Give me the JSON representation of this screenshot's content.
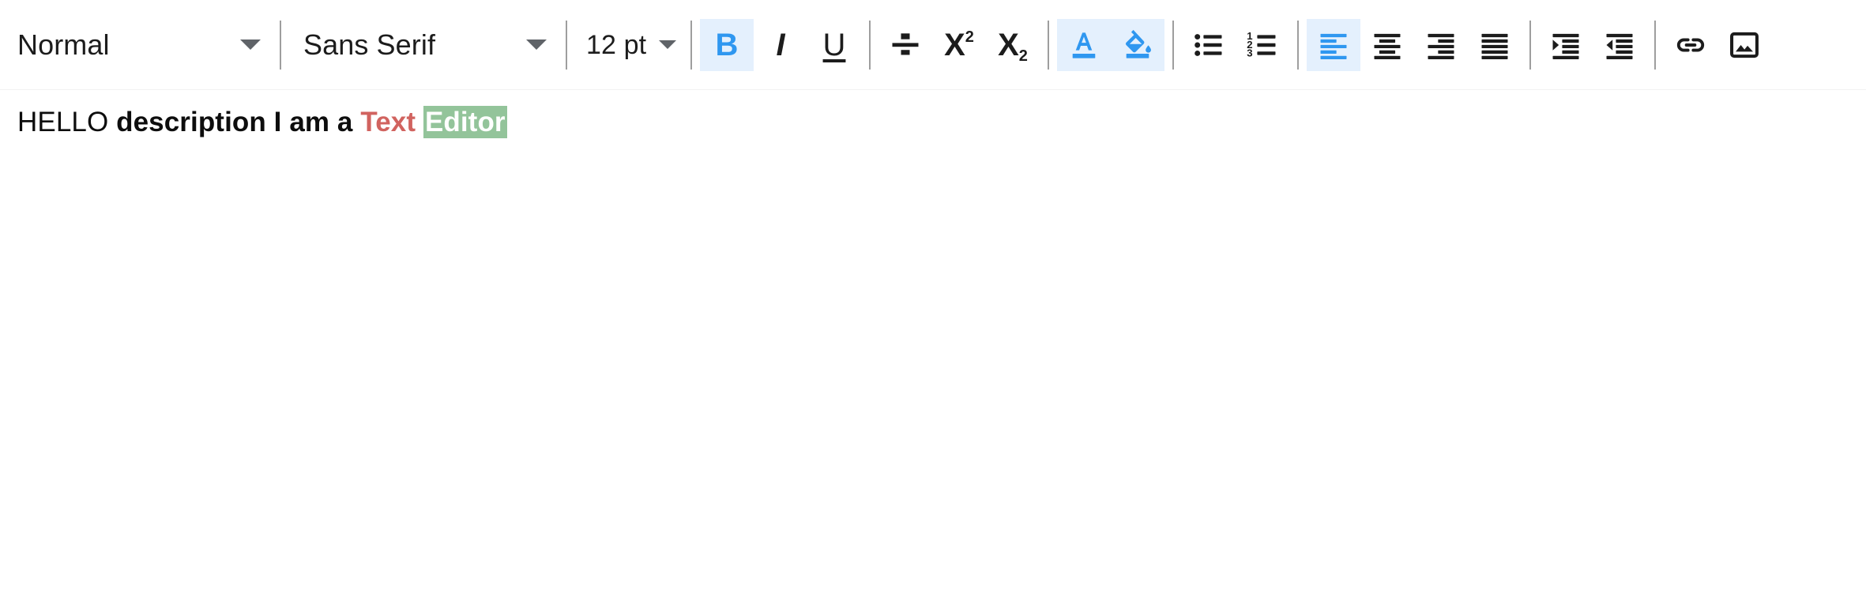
{
  "app": {
    "name": "rich-text-editor",
    "background": "#ffffff"
  },
  "colors": {
    "accent_blue": "#2f97f0",
    "active_background": "#e4f0fd",
    "icon_default": "#1c1c1c",
    "separator": "#9e9e9e",
    "caret": "#5f6368",
    "text_red": "#d1635f",
    "highlight_green": "#93c49a",
    "highlight_text": "#ffffff"
  },
  "toolbar": {
    "block_format": {
      "label": "Normal",
      "caret_icon": "chevron-down-icon",
      "options": [
        "Normal"
      ]
    },
    "font_family": {
      "label": "Sans Serif",
      "caret_icon": "chevron-down-icon",
      "options": [
        "Sans Serif"
      ]
    },
    "font_size": {
      "label": "12 pt",
      "caret_icon": "chevron-down-icon",
      "options": [
        "12 pt"
      ]
    },
    "buttons": [
      {
        "name": "bold-button",
        "icon": "bold-icon",
        "glyph": "B",
        "active": true,
        "title": "Bold"
      },
      {
        "name": "italic-button",
        "icon": "italic-icon",
        "glyph": "I",
        "active": false,
        "title": "Italic"
      },
      {
        "name": "underline-button",
        "icon": "underline-icon",
        "glyph": "U",
        "active": false,
        "title": "Underline"
      },
      {
        "name": "strikethrough-button",
        "icon": "strikethrough-icon",
        "glyph": "S",
        "active": false,
        "title": "Strikethrough"
      },
      {
        "name": "superscript-button",
        "icon": "superscript-icon",
        "glyph": "X2",
        "active": false,
        "title": "Superscript"
      },
      {
        "name": "subscript-button",
        "icon": "subscript-icon",
        "glyph": "X2",
        "active": false,
        "title": "Subscript"
      },
      {
        "name": "text-color-button",
        "icon": "text-color-icon",
        "glyph": "A",
        "active": true,
        "title": "Text color"
      },
      {
        "name": "highlight-color-button",
        "icon": "highlight-color-icon",
        "glyph": "",
        "active": true,
        "title": "Highlight color"
      },
      {
        "name": "bullet-list-button",
        "icon": "bullet-list-icon",
        "glyph": "",
        "active": false,
        "title": "Bulleted list"
      },
      {
        "name": "numbered-list-button",
        "icon": "numbered-list-icon",
        "glyph": "",
        "active": false,
        "title": "Numbered list"
      },
      {
        "name": "align-left-button",
        "icon": "align-left-icon",
        "glyph": "",
        "active": true,
        "title": "Align left"
      },
      {
        "name": "align-center-button",
        "icon": "align-center-icon",
        "glyph": "",
        "active": false,
        "title": "Align center"
      },
      {
        "name": "align-right-button",
        "icon": "align-right-icon",
        "glyph": "",
        "active": false,
        "title": "Align right"
      },
      {
        "name": "align-justify-button",
        "icon": "align-justify-icon",
        "glyph": "",
        "active": false,
        "title": "Justify"
      },
      {
        "name": "indent-increase-button",
        "icon": "indent-increase-icon",
        "glyph": "",
        "active": false,
        "title": "Increase indent"
      },
      {
        "name": "indent-decrease-button",
        "icon": "indent-decrease-icon",
        "glyph": "",
        "active": false,
        "title": "Decrease indent"
      },
      {
        "name": "insert-link-button",
        "icon": "link-icon",
        "glyph": "",
        "active": false,
        "title": "Insert link"
      },
      {
        "name": "insert-image-button",
        "icon": "image-icon",
        "glyph": "",
        "active": false,
        "title": "Insert image"
      }
    ],
    "labels": {
      "bold": "B",
      "italic": "I",
      "underline": "U",
      "superscript_base": "X",
      "superscript_exp": "2",
      "subscript_base": "X",
      "subscript_exp": "2",
      "text_color": "A",
      "list_number_1": "1",
      "list_number_2": "2",
      "list_number_3": "3"
    }
  },
  "editor": {
    "placeholder": "",
    "lines": [
      {
        "runs": [
          {
            "text": "HELLO ",
            "style": "plain"
          },
          {
            "text": "description I am a ",
            "style": "bold"
          },
          {
            "text": "Text",
            "style": "red"
          },
          {
            "text": " ",
            "style": "bold"
          },
          {
            "text": "Editor",
            "style": "highlight"
          }
        ]
      }
    ],
    "plain_text": "HELLO description I am a Text Editor"
  }
}
